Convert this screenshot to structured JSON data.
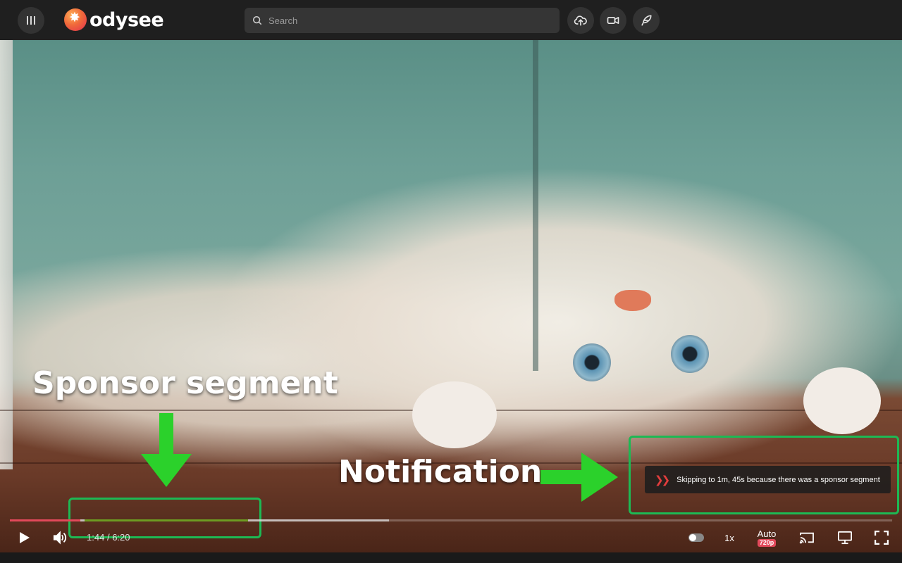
{
  "header": {
    "brand": "odysee",
    "search_placeholder": "Search",
    "icons": [
      "menu-icon",
      "upload-icon",
      "video-camera-icon",
      "feather-pen-icon"
    ]
  },
  "annotations": {
    "sponsor_label": "Sponsor segment",
    "notification_label": "Notification",
    "accent_color": "#1db954"
  },
  "notification": {
    "icon": "skip-chevrons-icon",
    "message": "Skipping to 1m, 45s because there was a sponsor segment"
  },
  "player": {
    "current_time": "1:44",
    "separator": "/",
    "duration": "6:20",
    "speed": "1x",
    "quality_label": "Auto",
    "quality_res": "720p",
    "played_fraction": 0.08,
    "buffered_fraction": 0.43,
    "sponsor_start_fraction": 0.085,
    "sponsor_end_fraction": 0.27,
    "colors": {
      "played": "#e2495b",
      "sponsor": "#6d9b22"
    }
  }
}
